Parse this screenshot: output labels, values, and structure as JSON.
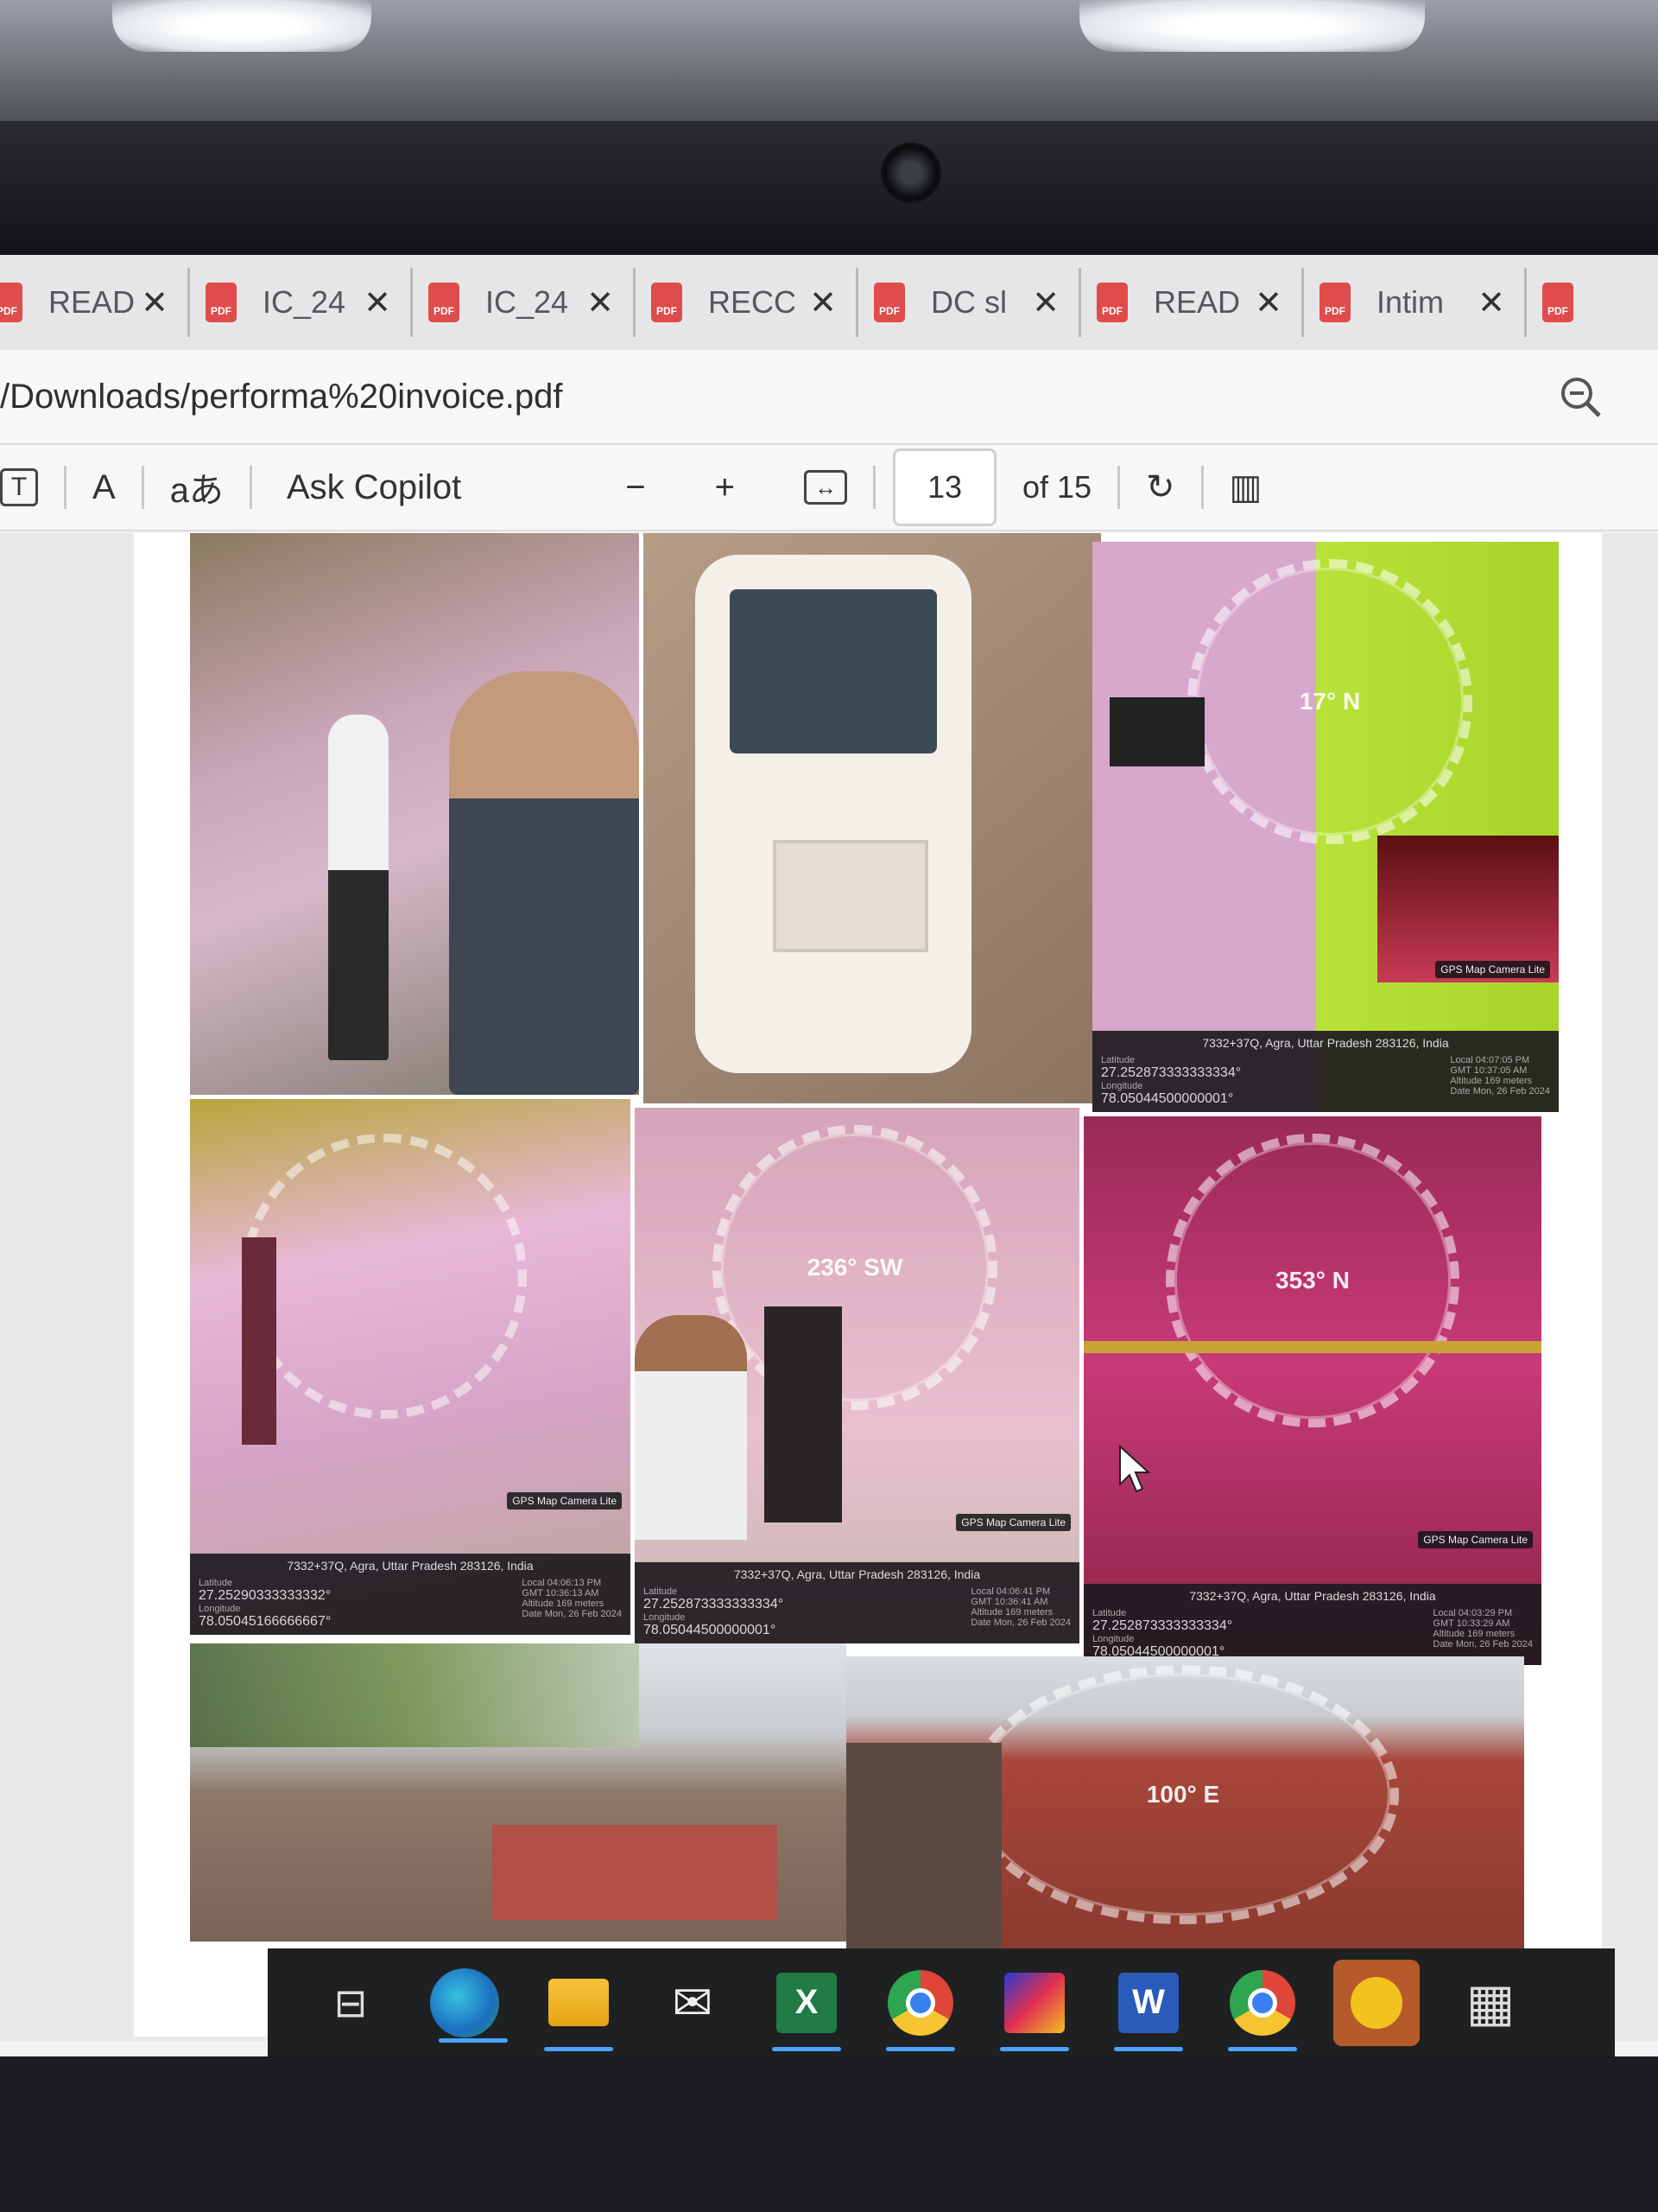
{
  "tabs": [
    {
      "title": "READ",
      "close": "✕"
    },
    {
      "title": "IC_24",
      "close": "✕"
    },
    {
      "title": "IC_24",
      "close": "✕"
    },
    {
      "title": "RECC",
      "close": "✕"
    },
    {
      "title": "DC sl",
      "close": "✕"
    },
    {
      "title": "READ",
      "close": "✕"
    },
    {
      "title": "Intim",
      "close": "✕"
    }
  ],
  "address": {
    "url": "/Downloads/performa%20invoice.pdf"
  },
  "toolbar": {
    "text_icon": "T",
    "read_aloud_icon": "A",
    "translate_icon": "aあ",
    "ask_label": "Ask Copilot",
    "zoom_out": "−",
    "zoom_in": "+",
    "fit_icon": "↔",
    "page_current": "13",
    "page_total": "of 15",
    "rotate_icon": "↻",
    "layout_icon": "▥"
  },
  "photos": [
    {
      "id": "p1"
    },
    {
      "id": "p2"
    },
    {
      "id": "p3",
      "compass": "17° N",
      "badge": "GPS Map Camera Lite",
      "address": "7332+37Q, Agra, Uttar Pradesh 283126, India",
      "lat_label": "Latitude",
      "lat": "27.252873333333334°",
      "lon_label": "Longitude",
      "lon": "78.05044500000001°",
      "local_label": "Local",
      "local": "04:07:05 PM",
      "gmt_label": "GMT",
      "gmt": "10:37:05 AM",
      "alt_label": "Altitude",
      "alt": "169 meters",
      "date_label": "Date",
      "date": "Mon, 26 Feb 2024"
    },
    {
      "id": "p4",
      "badge": "GPS Map Camera Lite",
      "address": "7332+37Q, Agra, Uttar Pradesh 283126, India",
      "lat_label": "Latitude",
      "lat": "27.25290333333332°",
      "lon_label": "Longitude",
      "lon": "78.05045166666667°",
      "local_label": "Local",
      "local": "04:06:13 PM",
      "gmt_label": "GMT",
      "gmt": "10:36:13 AM",
      "alt_label": "Altitude",
      "alt": "169 meters",
      "date_label": "Date",
      "date": "Mon, 26 Feb 2024"
    },
    {
      "id": "p5",
      "compass": "236° SW",
      "badge": "GPS Map Camera Lite",
      "address": "7332+37Q, Agra, Uttar Pradesh 283126, India",
      "lat_label": "Latitude",
      "lat": "27.252873333333334°",
      "lon_label": "Longitude",
      "lon": "78.05044500000001°",
      "local_label": "Local",
      "local": "04:06:41 PM",
      "gmt_label": "GMT",
      "gmt": "10:36:41 AM",
      "alt_label": "Altitude",
      "alt": "169 meters",
      "date_label": "Date",
      "date": "Mon, 26 Feb 2024"
    },
    {
      "id": "p6",
      "compass": "353° N",
      "badge": "GPS Map Camera Lite",
      "address": "7332+37Q, Agra, Uttar Pradesh 283126, India",
      "lat_label": "Latitude",
      "lat": "27.252873333333334°",
      "lon_label": "Longitude",
      "lon": "78.05044500000001°",
      "local_label": "Local",
      "local": "04:03:29 PM",
      "gmt_label": "GMT",
      "gmt": "10:33:29 AM",
      "alt_label": "Altitude",
      "alt": "169 meters",
      "date_label": "Date",
      "date": "Mon, 26 Feb 2024"
    },
    {
      "id": "p7"
    },
    {
      "id": "p8",
      "compass": "100° E"
    }
  ],
  "taskbar": {
    "icons": [
      "task-view-icon",
      "edge-icon",
      "file-explorer-icon",
      "mail-icon",
      "excel-icon",
      "chrome-icon",
      "paint-icon",
      "word-icon",
      "chrome-icon",
      "norton-icon",
      "calculator-icon"
    ]
  },
  "colors": {
    "pdf_icon": "#e04b4b",
    "taskbar": "#1f2022",
    "indicator": "#4aa3ff"
  }
}
